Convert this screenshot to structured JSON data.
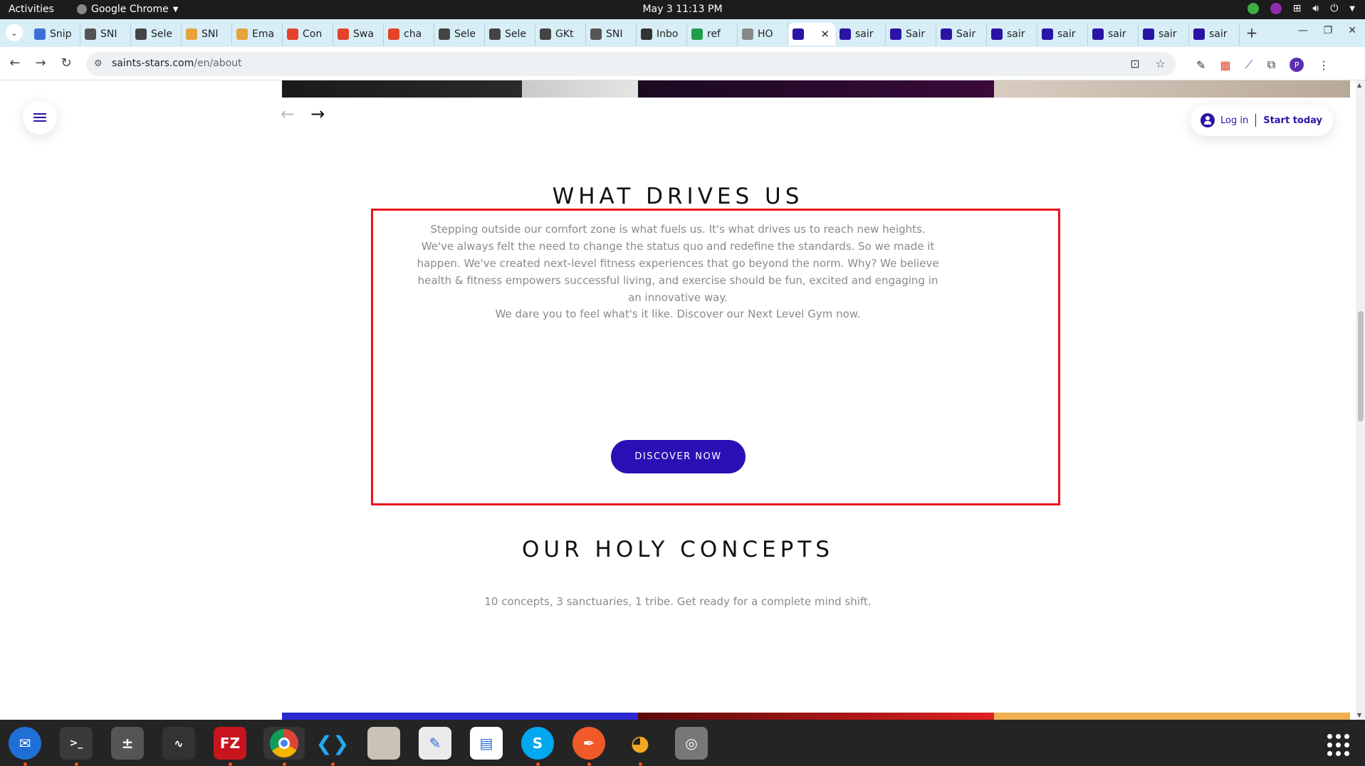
{
  "system_bar": {
    "activities": "Activities",
    "app_name": "Google Chrome",
    "clock": "May 3  11:13 PM"
  },
  "tabs": [
    {
      "label": "Snip",
      "color": "#3b6fd4"
    },
    {
      "label": "SNI",
      "color": "#555555"
    },
    {
      "label": "Sele",
      "color": "#444444"
    },
    {
      "label": "SNI",
      "color": "#e8a23c"
    },
    {
      "label": "Ema",
      "color": "#e8a23c"
    },
    {
      "label": "Con",
      "color": "#e24329"
    },
    {
      "label": "Swa",
      "color": "#e24329"
    },
    {
      "label": "cha",
      "color": "#e24329"
    },
    {
      "label": "Sele",
      "color": "#444444"
    },
    {
      "label": "Sele",
      "color": "#444444"
    },
    {
      "label": "GKt",
      "color": "#444444"
    },
    {
      "label": "SNI",
      "color": "#555555"
    },
    {
      "label": "Inbo",
      "color": "#333333"
    },
    {
      "label": "ref",
      "color": "#1e9e4a"
    },
    {
      "label": "HO",
      "color": "#888888"
    },
    {
      "label": "",
      "color": "#2a14a6",
      "active": true
    },
    {
      "label": "sair",
      "color": "#2a14a6"
    },
    {
      "label": "Sair",
      "color": "#2a14a6"
    },
    {
      "label": "Sair",
      "color": "#2a14a6"
    },
    {
      "label": "sair",
      "color": "#2a14a6"
    },
    {
      "label": "sair",
      "color": "#2a14a6"
    },
    {
      "label": "sair",
      "color": "#2a14a6"
    },
    {
      "label": "sair",
      "color": "#2a14a6"
    },
    {
      "label": "sair",
      "color": "#2a14a6"
    }
  ],
  "address_bar": {
    "domain": "saints-stars.com",
    "path": "/en/about"
  },
  "header": {
    "login": "Log in",
    "start": "Start today"
  },
  "drives": {
    "title": "WHAT DRIVES US",
    "body": "Stepping outside our comfort zone is what fuels us. It's what drives us to reach new heights. We've always felt the need to change the status quo and redefine the standards. So we made it happen. We've created next-level fitness experiences that go beyond the norm. Why? We believe health & fitness empowers successful living, and exercise should be fun, excited and engaging in an innovative way.",
    "dare": "We dare you to feel what's it like. Discover our Next Level Gym now.",
    "button": "DISCOVER NOW"
  },
  "concepts": {
    "title": "OUR HOLY CONCEPTS",
    "subtitle": "10 concepts, 3 sanctuaries, 1 tribe. Get ready for a complete mind shift."
  },
  "colors": {
    "brand": "#2a0fb5",
    "highlight": "#e8141c"
  }
}
